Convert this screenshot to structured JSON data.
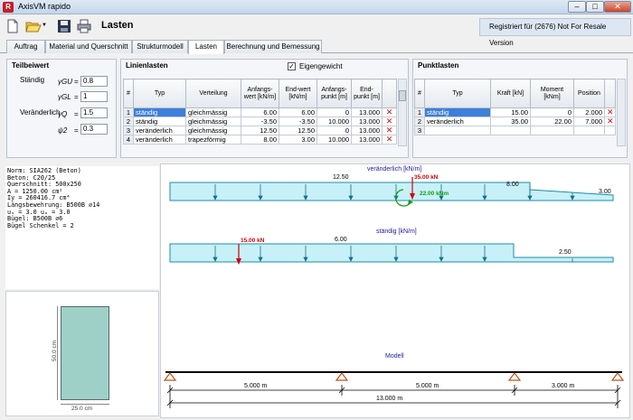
{
  "window": {
    "title": "AxisVM rapido",
    "app_icon": "R",
    "min": "–",
    "max": "□",
    "close": "✕"
  },
  "toolbar": {
    "page_title": "Lasten",
    "registered": "Registriert für  (2676)  Not For Resale Version"
  },
  "tabs": [
    "Auftrag",
    "Material und Querschnitt",
    "Strukturmodell",
    "Lasten",
    "Berechnung und Bemessung"
  ],
  "teilbeiwert": {
    "title": "Teilbeiwert",
    "staendig_label": "Ständig",
    "veraenderlich_label": "Veränderlich",
    "gGU": {
      "label": "γGU",
      "value": "0.8"
    },
    "gGL": {
      "label": "γGL",
      "value": "1"
    },
    "gQ": {
      "label": "γQ",
      "value": "1.5"
    },
    "psi2": {
      "label": "ψ2",
      "value": "0.3"
    }
  },
  "linienlasten": {
    "title": "Linienlasten",
    "eigengewicht_label": "Eigengewicht",
    "eigengewicht_checked": true,
    "headers": [
      "#",
      "Typ",
      "Verteilung",
      "Anfangs-wert [kN/m]",
      "End-wert [kN/m]",
      "Anfangs-punkt [m]",
      "End-punkt [m]"
    ],
    "rows": [
      [
        "1",
        "ständig",
        "gleichmässig",
        "6.00",
        "6.00",
        "0",
        "13.000"
      ],
      [
        "2",
        "ständig",
        "gleichmässig",
        "-3.50",
        "-3.50",
        "10.000",
        "13.000"
      ],
      [
        "3",
        "veränderlich",
        "gleichmässig",
        "12.50",
        "12.50",
        "0",
        "13.000"
      ],
      [
        "4",
        "veränderlich",
        "trapezförmig",
        "8.00",
        "3.00",
        "10.000",
        "13.000"
      ]
    ]
  },
  "punktlasten": {
    "title": "Punktlasten",
    "headers": [
      "#",
      "Typ",
      "Kraft [kN]",
      "Moment [kNm]",
      "Position"
    ],
    "rows": [
      [
        "1",
        "ständig",
        "15.00",
        "0",
        "2.000"
      ],
      [
        "2",
        "veränderlich",
        "35.00",
        "22.00",
        "7.000"
      ],
      [
        "3",
        "",
        "",
        "",
        ""
      ]
    ]
  },
  "info": [
    "Norm: SIA262 (Beton)",
    "Beton: C20/25",
    "Querschnitt: 500x250",
    "A = 1250.00 cm²",
    "Iy = 260416.7 cm⁴",
    "Längsbewehrung: B500B ⌀14",
    "uₛ = 3.0  uₒ = 3.0",
    "Bügel: B500B ⌀6",
    "Bügel Schenkel = 2"
  ],
  "section": {
    "height_label": "50.0 cm",
    "width_label": "25.0 cm"
  },
  "diagram": {
    "veraenderlich": {
      "title": "veränderlich [kN/m]",
      "val1": "12.50",
      "val2": "8.00",
      "val3": "3.00",
      "force": "35.00 kN",
      "moment": "22.00 kNm"
    },
    "staendig": {
      "title": "ständig [kN/m]",
      "val1": "6.00",
      "val2": "2.50",
      "force": "15.00 kN"
    },
    "modell": {
      "title": "Modell",
      "dim1": "5.000 m",
      "dim2": "5.000 m",
      "dim3": "3.000 m",
      "total": "13.000 m"
    }
  },
  "colors": {
    "load_fill": "#c8f0f8",
    "load_stroke": "#1a8fa6",
    "force": "#d00000",
    "moment": "#10a010",
    "support": "#c05010",
    "label_blue": "#1a1aa0"
  }
}
